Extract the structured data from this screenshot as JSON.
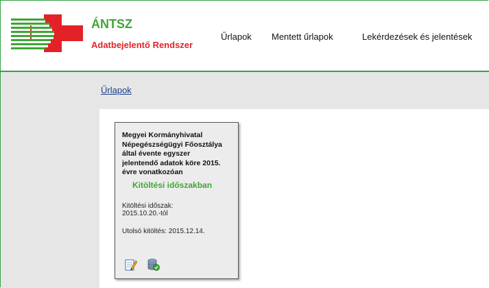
{
  "header": {
    "brand_name": "ÁNTSZ",
    "brand_sub": "Adatbejelentő Rendszer",
    "nav": [
      {
        "label": "Űrlapok"
      },
      {
        "label": "Mentett űrlapok"
      },
      {
        "label": "Lekérdezések és jelentések"
      }
    ]
  },
  "breadcrumb": {
    "label": "Űrlapok"
  },
  "card": {
    "title_lines": [
      "Megyei Kormányhivatal",
      "Népegészségügyi Főosztálya",
      "által évente egyszer",
      "jelentendő adatok köre 2015.",
      "évre vonatkozóan"
    ],
    "status": "Kitöltési időszakban",
    "period_label": "Kitöltési időszak:",
    "period_value": "2015.10.20.-tól",
    "last_fill": "Utolsó kitöltés: 2015.12.14.",
    "icons": [
      "edit-form-icon",
      "database-icon"
    ]
  },
  "colors": {
    "brand_green": "#3fa535",
    "brand_red": "#e32228",
    "link_blue": "#1a3d8f"
  }
}
